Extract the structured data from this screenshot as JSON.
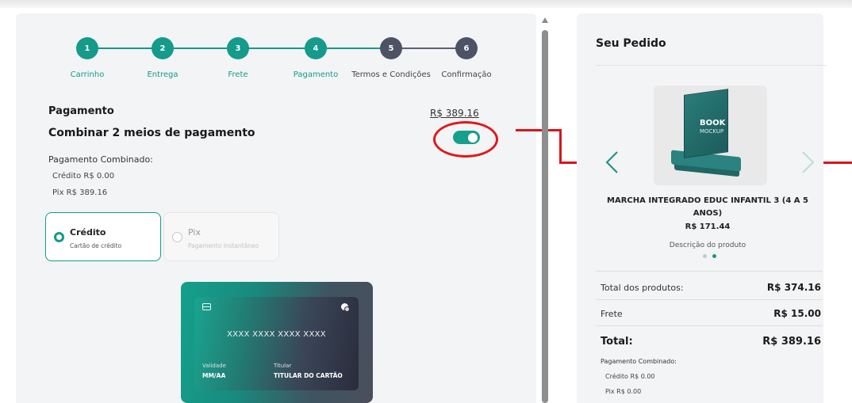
{
  "stepper": {
    "steps": [
      {
        "number": "1",
        "label": "Carrinho",
        "state": "active"
      },
      {
        "number": "2",
        "label": "Entrega",
        "state": "active"
      },
      {
        "number": "3",
        "label": "Frete",
        "state": "active"
      },
      {
        "number": "4",
        "label": "Pagamento",
        "state": "active"
      },
      {
        "number": "5",
        "label": "Termos e Condições",
        "state": "inactive"
      },
      {
        "number": "6",
        "label": "Confirmação",
        "state": "inactive"
      }
    ]
  },
  "payment": {
    "title": "Pagamento",
    "total": "R$ 389.16",
    "combine_title": "Combinar 2 meios de pagamento",
    "combine_toggle_on": true,
    "combined_label": "Pagamento Combinado:",
    "combined_credit": "Crédito R$ 0.00",
    "combined_pix": "Pix R$ 389.16",
    "methods": [
      {
        "name": "Crédito",
        "sub": "Cartão de crédito",
        "selected": true
      },
      {
        "name": "Pix",
        "sub": "Pagamento instantâneo",
        "selected": false
      }
    ]
  },
  "card": {
    "number": "XXXX XXXX XXXX XXXX",
    "validity_label": "Validade",
    "validity_value": "MM/AA",
    "holder_label": "Titular",
    "holder_value": "TITULAR DO CARTÃO"
  },
  "order": {
    "title": "Seu Pedido",
    "product": {
      "image_text_1": "BOOK",
      "image_text_2": "MOCKUP",
      "name": "MARCHA INTEGRADO EDUC INFANTIL 3 (4 A 5 ANOS)",
      "price": "R$ 171.44",
      "description": "Descrição do produto"
    },
    "summary": {
      "products_label": "Total dos produtos:",
      "products_value": "R$ 374.16",
      "shipping_label": "Frete",
      "shipping_value": "R$ 15.00",
      "total_label": "Total:",
      "total_value": "R$ 389.16",
      "combined_label": "Pagamento Combinado:",
      "combined_credit": "Crédito R$ 0.00",
      "combined_pix": "Pix R$ 0.00"
    }
  },
  "colors": {
    "accent": "#159a8b",
    "inactive_step": "#4d5264",
    "annotation": "#e0191d"
  }
}
